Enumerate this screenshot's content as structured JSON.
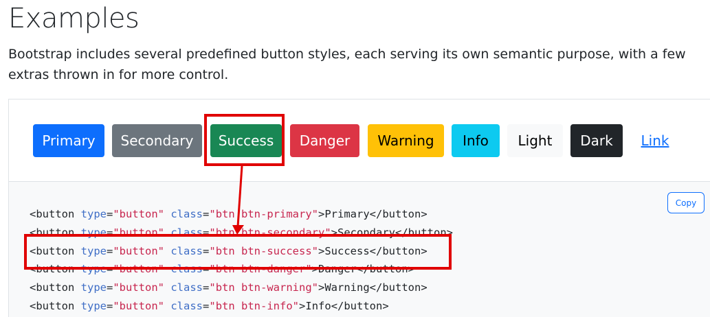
{
  "page": {
    "title": "Examples",
    "lead": "Bootstrap includes several predefined button styles, each serving its own semantic purpose, with a few extras thrown in for more control."
  },
  "buttons": [
    {
      "label": "Primary",
      "bg": "#0d6efd",
      "fg": "#ffffff"
    },
    {
      "label": "Secondary",
      "bg": "#6c757d",
      "fg": "#ffffff"
    },
    {
      "label": "Success",
      "bg": "#198754",
      "fg": "#ffffff"
    },
    {
      "label": "Danger",
      "bg": "#dc3545",
      "fg": "#ffffff"
    },
    {
      "label": "Warning",
      "bg": "#ffc107",
      "fg": "#000000"
    },
    {
      "label": "Info",
      "bg": "#0dcaf0",
      "fg": "#000000"
    },
    {
      "label": "Light",
      "bg": "#f8f9fa",
      "fg": "#000000"
    },
    {
      "label": "Dark",
      "bg": "#212529",
      "fg": "#ffffff"
    },
    {
      "label": "Link",
      "bg": "transparent",
      "fg": "#0d6efd"
    }
  ],
  "code": {
    "copy_label": "Copy",
    "lines": [
      {
        "cls": "btn btn-primary",
        "text": "Primary"
      },
      {
        "cls": "btn btn-secondary",
        "text": "Secondary"
      },
      {
        "cls": "btn btn-success",
        "text": "Success"
      },
      {
        "cls": "btn btn-danger",
        "text": "Danger"
      },
      {
        "cls": "btn btn-warning",
        "text": "Warning"
      },
      {
        "cls": "btn btn-info",
        "text": "Info"
      }
    ]
  },
  "annotation": {
    "color": "#e00000",
    "target": "Success"
  }
}
